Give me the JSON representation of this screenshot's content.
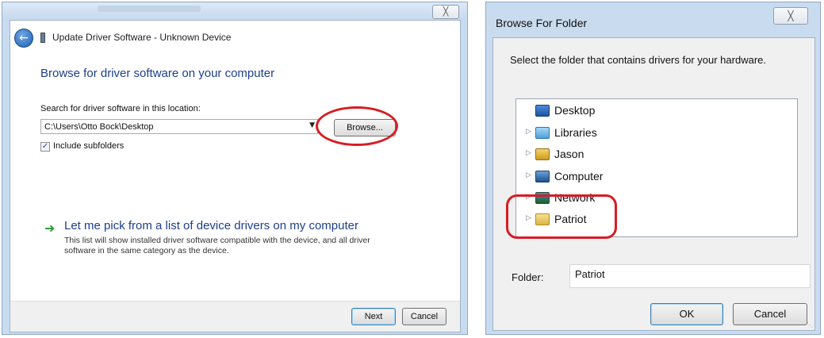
{
  "left_window": {
    "close_glyph": "╳",
    "header_title": "Update Driver Software - Unknown Device",
    "instruction": "Browse for driver software on your computer",
    "search_label": "Search for driver software in this location:",
    "path_value": "C:\\Users\\Otto Bock\\Desktop",
    "browse_label": "Browse...",
    "include_subfolders": {
      "checked": true,
      "label": "Include subfolders"
    },
    "pick_link": "Let me pick from a list of device drivers on my computer",
    "pick_desc": "This list will show installed driver software compatible with the device, and all driver software in the same category as the device.",
    "next_label": "Next",
    "cancel_label": "Cancel"
  },
  "right_window": {
    "title": "Browse For Folder",
    "close_glyph": "╳",
    "prompt": "Select the folder that contains drivers for your hardware.",
    "tree": [
      {
        "label": "Desktop",
        "icon": "desktop-icon",
        "expandable": false
      },
      {
        "label": "Libraries",
        "icon": "libraries-icon",
        "expandable": true
      },
      {
        "label": "Jason",
        "icon": "user-folder-icon",
        "expandable": true
      },
      {
        "label": "Computer",
        "icon": "computer-icon",
        "expandable": true
      },
      {
        "label": "Network",
        "icon": "network-icon",
        "expandable": true
      },
      {
        "label": "Patriot",
        "icon": "folder-icon",
        "expandable": true
      }
    ],
    "folder_label": "Folder:",
    "folder_value": "Patriot",
    "ok_label": "OK",
    "cancel_label": "Cancel"
  },
  "colors": {
    "link_blue": "#1e3f8c",
    "annotation_red": "#d61d24",
    "frame_blue": "#c9dcef"
  }
}
